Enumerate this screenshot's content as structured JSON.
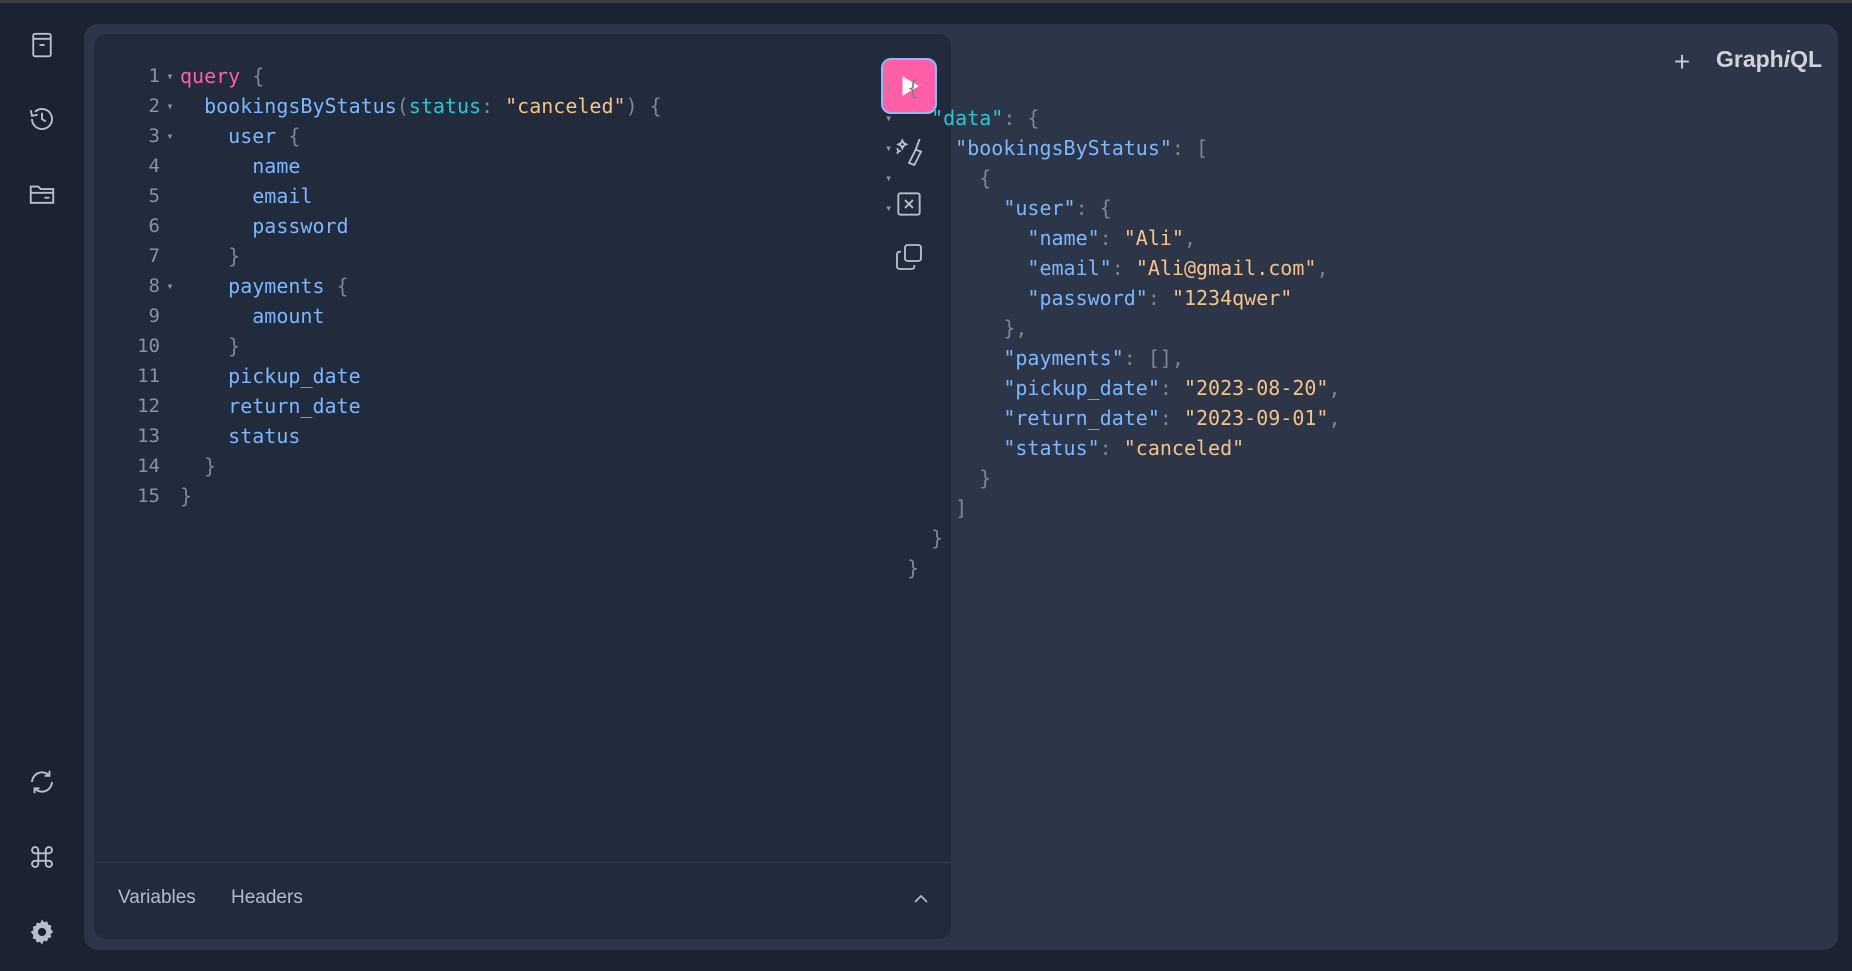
{
  "app": {
    "title": "GraphiQL",
    "logo_parts": [
      "Graph",
      "i",
      "QL"
    ]
  },
  "sidebar": {
    "top_items": [
      {
        "name": "docs-icon"
      },
      {
        "name": "history-icon"
      },
      {
        "name": "explorer-icon"
      }
    ],
    "bottom_items": [
      {
        "name": "refetch-schema-icon"
      },
      {
        "name": "shortcuts-icon"
      },
      {
        "name": "settings-icon"
      }
    ]
  },
  "toolbar": {
    "run": "run-query",
    "prettify": "prettify-icon",
    "merge": "merge-fragments-icon",
    "copy": "copy-icon"
  },
  "editor": {
    "lines": [
      {
        "n": "1",
        "fold": "▾",
        "tokens": [
          [
            "kw",
            "query"
          ],
          [
            "pun",
            " {"
          ]
        ]
      },
      {
        "n": "2",
        "fold": "▾",
        "tokens": [
          [
            "sp",
            "  "
          ],
          [
            "fld",
            "bookingsByStatus"
          ],
          [
            "pun",
            "("
          ],
          [
            "arg",
            "status"
          ],
          [
            "pun",
            ": "
          ],
          [
            "str",
            "\"canceled\""
          ],
          [
            "pun",
            ") {"
          ]
        ]
      },
      {
        "n": "3",
        "fold": "▾",
        "tokens": [
          [
            "sp",
            "    "
          ],
          [
            "fld",
            "user"
          ],
          [
            "pun",
            " {"
          ]
        ]
      },
      {
        "n": "4",
        "fold": "",
        "tokens": [
          [
            "sp",
            "      "
          ],
          [
            "fld",
            "name"
          ]
        ]
      },
      {
        "n": "5",
        "fold": "",
        "tokens": [
          [
            "sp",
            "      "
          ],
          [
            "fld",
            "email"
          ]
        ]
      },
      {
        "n": "6",
        "fold": "",
        "tokens": [
          [
            "sp",
            "      "
          ],
          [
            "fld",
            "password"
          ]
        ]
      },
      {
        "n": "7",
        "fold": "",
        "tokens": [
          [
            "sp",
            "    "
          ],
          [
            "pun",
            "}"
          ]
        ]
      },
      {
        "n": "8",
        "fold": "▾",
        "tokens": [
          [
            "sp",
            "    "
          ],
          [
            "fld",
            "payments"
          ],
          [
            "pun",
            " {"
          ]
        ]
      },
      {
        "n": "9",
        "fold": "",
        "tokens": [
          [
            "sp",
            "      "
          ],
          [
            "fld",
            "amount"
          ]
        ]
      },
      {
        "n": "10",
        "fold": "",
        "tokens": [
          [
            "sp",
            "    "
          ],
          [
            "pun",
            "}"
          ]
        ]
      },
      {
        "n": "11",
        "fold": "",
        "tokens": [
          [
            "sp",
            "    "
          ],
          [
            "fld",
            "pickup_date"
          ]
        ]
      },
      {
        "n": "12",
        "fold": "",
        "tokens": [
          [
            "sp",
            "    "
          ],
          [
            "fld",
            "return_date"
          ]
        ]
      },
      {
        "n": "13",
        "fold": "",
        "tokens": [
          [
            "sp",
            "    "
          ],
          [
            "fld",
            "status"
          ]
        ]
      },
      {
        "n": "14",
        "fold": "",
        "tokens": [
          [
            "sp",
            "  "
          ],
          [
            "pun",
            "}"
          ]
        ]
      },
      {
        "n": "15",
        "fold": "",
        "tokens": [
          [
            "pun",
            "}"
          ]
        ]
      }
    ]
  },
  "bottom_tabs": {
    "variables": "Variables",
    "headers": "Headers"
  },
  "result": {
    "lines": [
      {
        "fold": "▾",
        "tokens": [
          [
            "pun",
            "{"
          ]
        ]
      },
      {
        "fold": "▾",
        "tokens": [
          [
            "sp",
            "  "
          ],
          [
            "arg",
            "\"data\""
          ],
          [
            "pun",
            ": {"
          ]
        ]
      },
      {
        "fold": "▾",
        "tokens": [
          [
            "sp",
            "    "
          ],
          [
            "key",
            "\"bookingsByStatus\""
          ],
          [
            "pun",
            ": ["
          ]
        ]
      },
      {
        "fold": "▾",
        "tokens": [
          [
            "sp",
            "      "
          ],
          [
            "pun",
            "{"
          ]
        ]
      },
      {
        "fold": "▾",
        "tokens": [
          [
            "sp",
            "        "
          ],
          [
            "key",
            "\"user\""
          ],
          [
            "pun",
            ": {"
          ]
        ]
      },
      {
        "fold": "",
        "tokens": [
          [
            "sp",
            "          "
          ],
          [
            "key",
            "\"name\""
          ],
          [
            "pun",
            ": "
          ],
          [
            "str",
            "\"Ali\""
          ],
          [
            "pun",
            ","
          ]
        ]
      },
      {
        "fold": "",
        "tokens": [
          [
            "sp",
            "          "
          ],
          [
            "key",
            "\"email\""
          ],
          [
            "pun",
            ": "
          ],
          [
            "str",
            "\"Ali@gmail.com\""
          ],
          [
            "pun",
            ","
          ]
        ]
      },
      {
        "fold": "",
        "tokens": [
          [
            "sp",
            "          "
          ],
          [
            "key",
            "\"password\""
          ],
          [
            "pun",
            ": "
          ],
          [
            "str",
            "\"1234qwer\""
          ]
        ]
      },
      {
        "fold": "",
        "tokens": [
          [
            "sp",
            "        "
          ],
          [
            "pun",
            "},"
          ]
        ]
      },
      {
        "fold": "",
        "tokens": [
          [
            "sp",
            "        "
          ],
          [
            "key",
            "\"payments\""
          ],
          [
            "pun",
            ": [],"
          ]
        ]
      },
      {
        "fold": "",
        "tokens": [
          [
            "sp",
            "        "
          ],
          [
            "key",
            "\"pickup_date\""
          ],
          [
            "pun",
            ": "
          ],
          [
            "str",
            "\"2023-08-20\""
          ],
          [
            "pun",
            ","
          ]
        ]
      },
      {
        "fold": "",
        "tokens": [
          [
            "sp",
            "        "
          ],
          [
            "key",
            "\"return_date\""
          ],
          [
            "pun",
            ": "
          ],
          [
            "str",
            "\"2023-09-01\""
          ],
          [
            "pun",
            ","
          ]
        ]
      },
      {
        "fold": "",
        "tokens": [
          [
            "sp",
            "        "
          ],
          [
            "key",
            "\"status\""
          ],
          [
            "pun",
            ": "
          ],
          [
            "str",
            "\"canceled\""
          ]
        ]
      },
      {
        "fold": "",
        "tokens": [
          [
            "sp",
            "      "
          ],
          [
            "pun",
            "}"
          ]
        ]
      },
      {
        "fold": "",
        "tokens": [
          [
            "sp",
            "    "
          ],
          [
            "pun",
            "]"
          ]
        ]
      },
      {
        "fold": "",
        "tokens": [
          [
            "sp",
            "  "
          ],
          [
            "pun",
            "}"
          ]
        ]
      },
      {
        "fold": "",
        "tokens": [
          [
            "pun",
            "}"
          ]
        ]
      }
    ]
  },
  "colors": {
    "background": "#1b2333",
    "panel": "#2d3648",
    "editor": "#212b3b",
    "accent": "#ff5fa6",
    "field": "#7cb6ff",
    "argument": "#2ec4d6",
    "string": "#f4c38a",
    "punctuation": "#7d8597"
  }
}
